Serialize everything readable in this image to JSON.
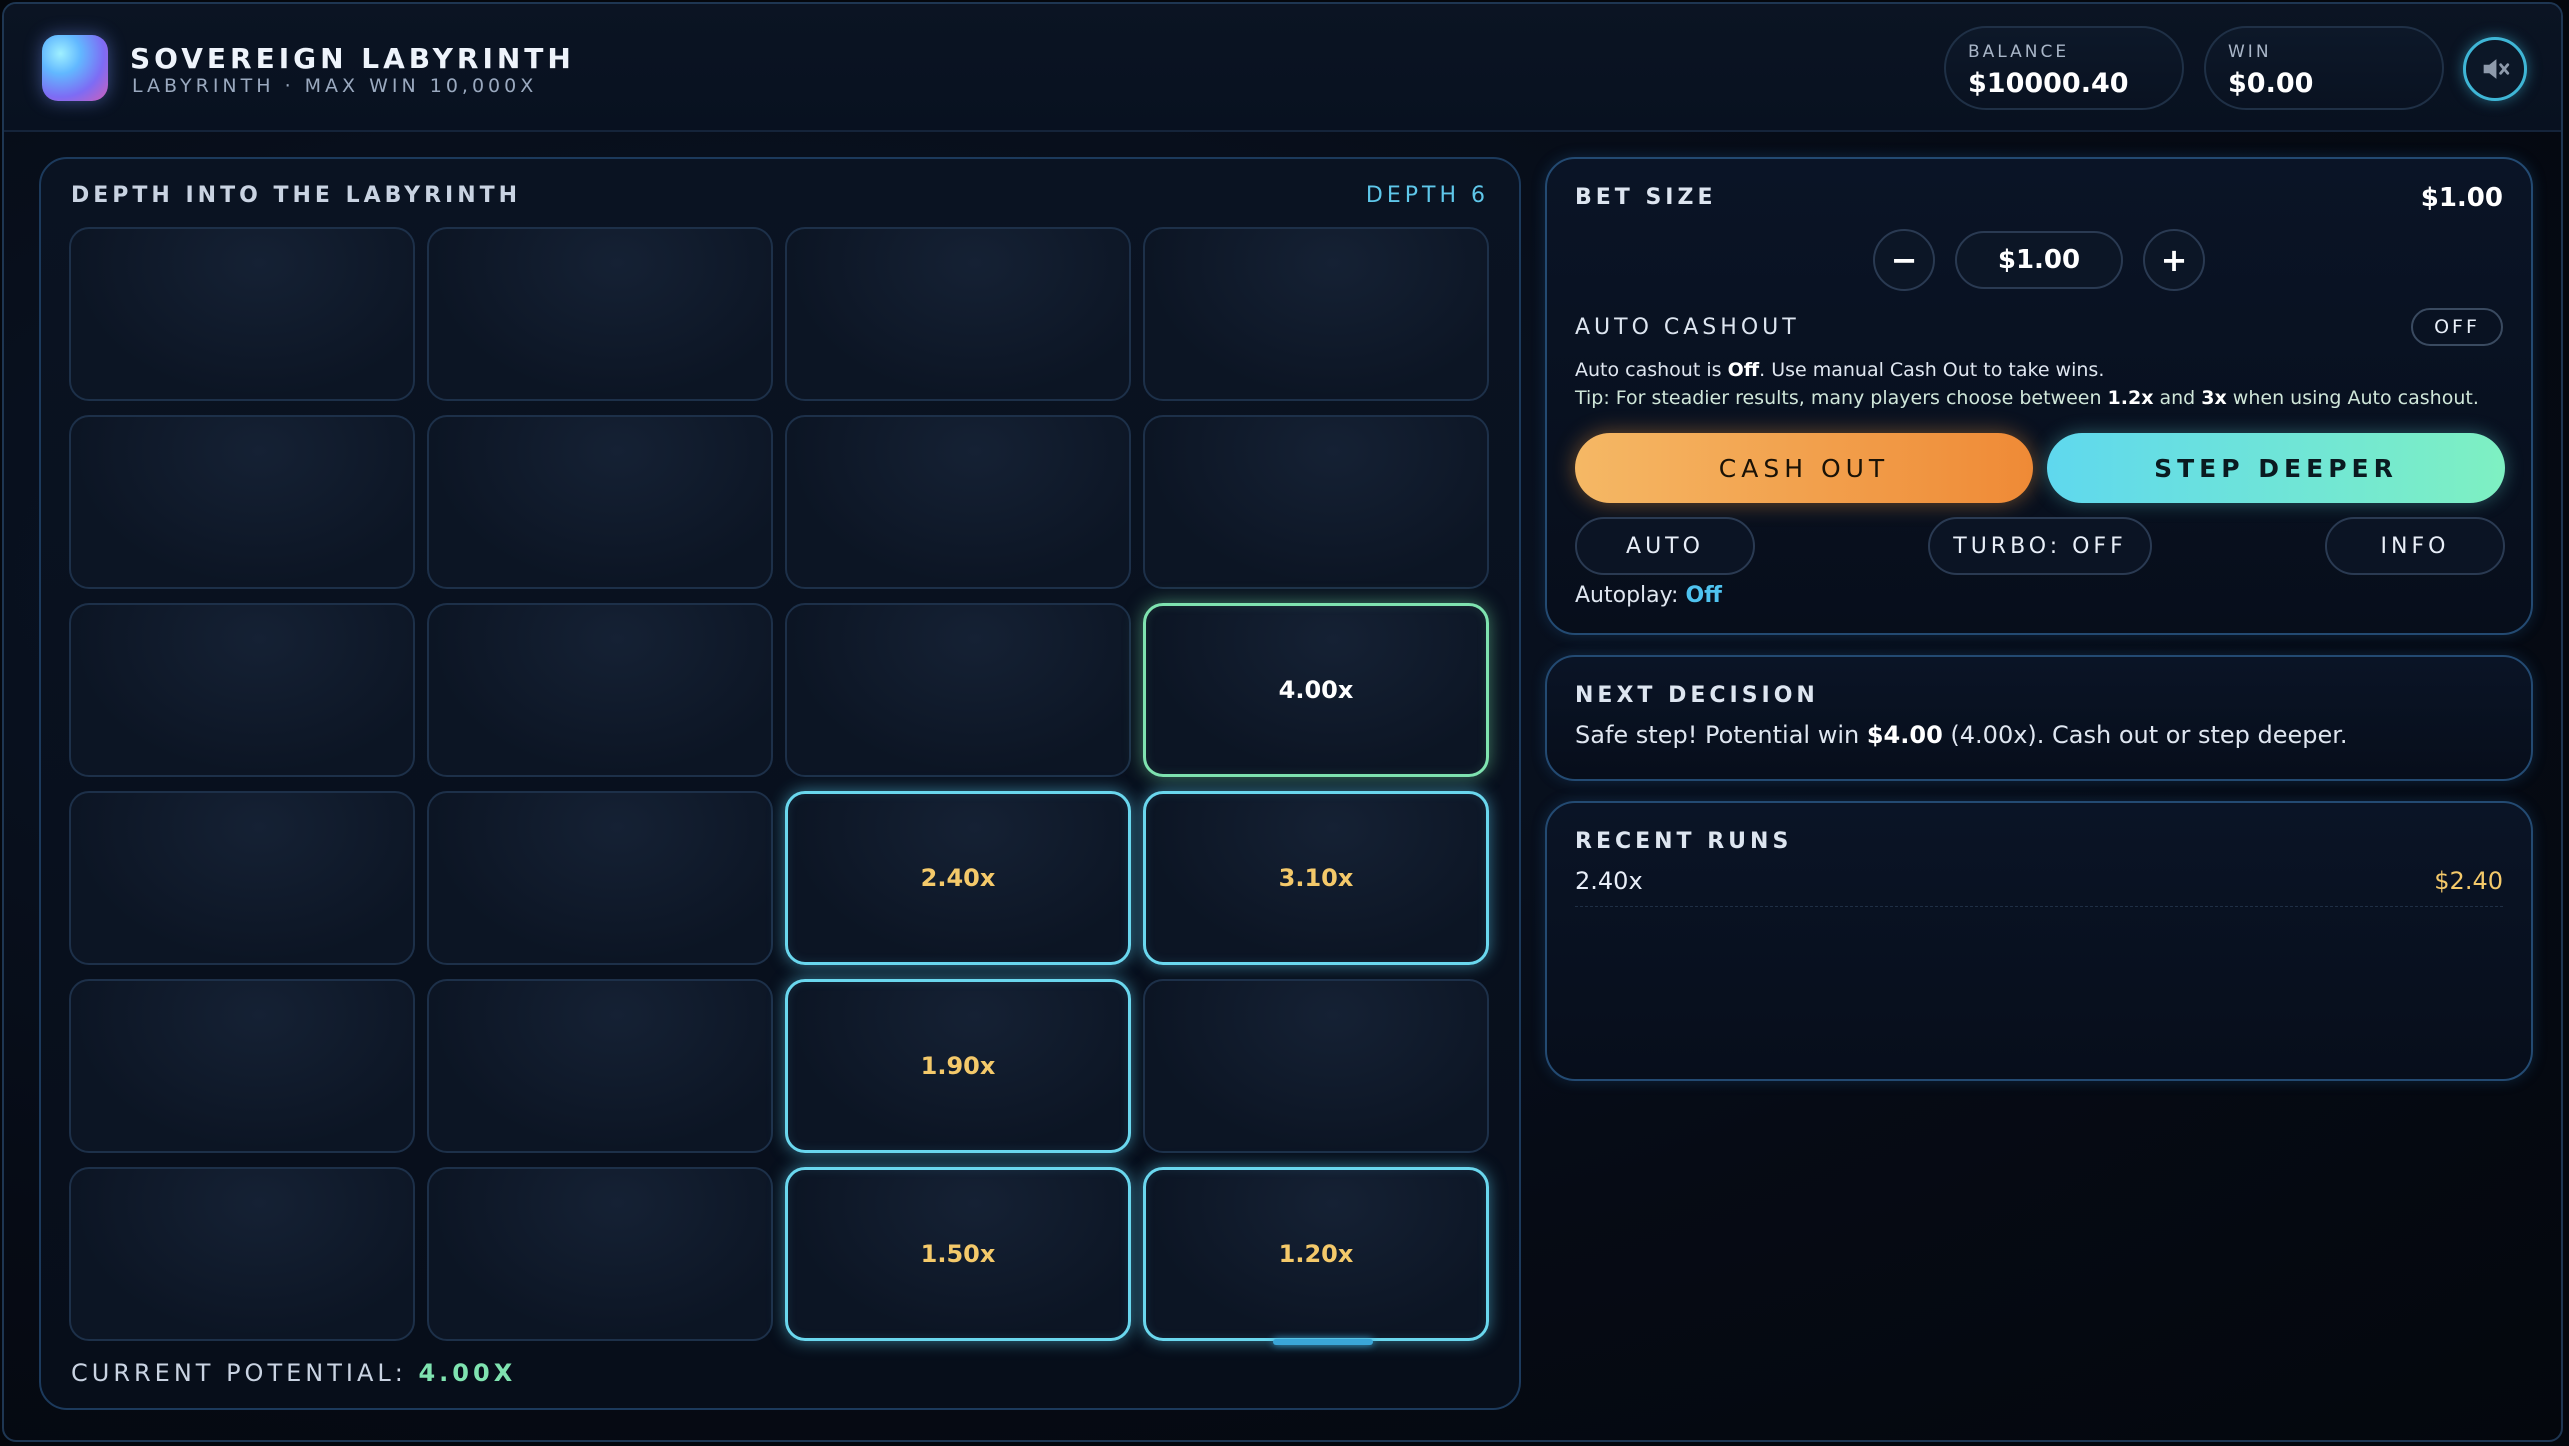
{
  "header": {
    "title": "SOVEREIGN LABYRINTH",
    "subtitle": "LABYRINTH · MAX WIN 10,000X",
    "balance_label": "BALANCE",
    "balance_value": "$10000.40",
    "win_label": "WIN",
    "win_value": "$0.00",
    "sound_icon": "speaker-muted-icon"
  },
  "grid": {
    "label": "DEPTH INTO THE LABYRINTH",
    "depth_label": "DEPTH 6",
    "rows": [
      [
        {
          "text": "",
          "state": "hidden"
        },
        {
          "text": "",
          "state": "hidden"
        },
        {
          "text": "",
          "state": "hidden"
        },
        {
          "text": "",
          "state": "hidden"
        }
      ],
      [
        {
          "text": "",
          "state": "hidden"
        },
        {
          "text": "",
          "state": "hidden"
        },
        {
          "text": "",
          "state": "hidden"
        },
        {
          "text": "",
          "state": "hidden"
        }
      ],
      [
        {
          "text": "",
          "state": "hidden"
        },
        {
          "text": "",
          "state": "hidden"
        },
        {
          "text": "",
          "state": "hidden"
        },
        {
          "text": "4.00x",
          "state": "current"
        }
      ],
      [
        {
          "text": "",
          "state": "hidden"
        },
        {
          "text": "",
          "state": "hidden"
        },
        {
          "text": "2.40x",
          "state": "safe"
        },
        {
          "text": "3.10x",
          "state": "safe"
        }
      ],
      [
        {
          "text": "",
          "state": "hidden"
        },
        {
          "text": "",
          "state": "hidden"
        },
        {
          "text": "1.90x",
          "state": "safe"
        },
        {
          "text": "",
          "state": "hidden"
        }
      ],
      [
        {
          "text": "",
          "state": "hidden"
        },
        {
          "text": "",
          "state": "hidden"
        },
        {
          "text": "1.50x",
          "state": "safe"
        },
        {
          "text": "1.20x",
          "state": "safe"
        }
      ]
    ],
    "potential_label": "CURRENT POTENTIAL:",
    "potential_value": "4.00X"
  },
  "bet": {
    "title": "BET SIZE",
    "value_top": "$1.00",
    "minus_label": "−",
    "plus_label": "+",
    "value": "$1.00",
    "auto_cashout_label": "AUTO CASHOUT",
    "auto_cashout_toggle": "OFF",
    "note_prefix": "Auto cashout is ",
    "note_bold": "Off",
    "note_suffix": ". Use manual Cash Out to take wins.",
    "tip_prefix": "Tip: For steadier results, many players choose between ",
    "tip_low": "1.2x",
    "tip_mid": " and ",
    "tip_high": "3x",
    "tip_suffix": " when using Auto cashout.",
    "cash_out_label": "CASH OUT",
    "step_deeper_label": "STEP DEEPER",
    "auto_label": "AUTO",
    "turbo_label": "TURBO: OFF",
    "info_label": "INFO",
    "autoplay_label": "Autoplay: ",
    "autoplay_value": "Off"
  },
  "decision": {
    "title": "NEXT DECISION",
    "prefix": "Safe step! Potential win ",
    "amount": "$4.00",
    "suffix": " (4.00x). Cash out or step deeper."
  },
  "recent": {
    "title": "RECENT RUNS",
    "runs": [
      {
        "multiplier": "2.40x",
        "win": "$2.40"
      }
    ]
  },
  "colors": {
    "accent_cyan": "#6ad7ee",
    "accent_green": "#7fe3b0",
    "multiplier_gold": "#f4c96a",
    "cash_out_orange": "#ef8a36"
  }
}
